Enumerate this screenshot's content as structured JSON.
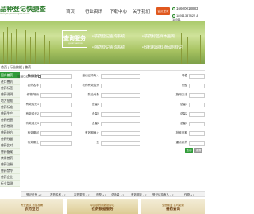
{
  "header": {
    "logo_text": "品种登记快捷查",
    "logo_sub": "Variety Registration Quick Search",
    "nav": [
      "首页",
      "行业资讯",
      "下载中心",
      "关于我们"
    ],
    "login_label": "会员登录",
    "phone1": "16600018883",
    "phone2": "18911387822 & 18911"
  },
  "banner": {
    "title": "查询服务",
    "title_en": "QUERY SERVICE",
    "items": [
      "农药登记查询系统",
      "农药标签样本查询",
      "农药标签化肥登记",
      "兽药登记查询系统",
      "饲料和饲料添加剂登记",
      "健康饲料登记查询"
    ]
  },
  "breadcrumb": [
    "首页",
    "行业数据",
    "兽药"
  ],
  "sidebar": {
    "items": [
      "国产兽药",
      "进口兽药",
      "兽药标签",
      "兽药说明",
      "地方批准",
      "兽药标准",
      "兽药生产",
      "兽药经营",
      "兽药检测",
      "兽药处方",
      "兽药残留",
      "兽药比对",
      "兽药备案",
      "禁用兽药",
      "兽药注册",
      "兽药禁令",
      "兽药企业",
      "行业监测"
    ],
    "active_index": 0
  },
  "form": {
    "rows": [
      [
        "登记证号",
        "登记证持有人",
        "毒性"
      ],
      [
        "农药名称",
        "农药有效成分",
        "剂型"
      ],
      [
        "作物/场所",
        "防治对象",
        "施用方法"
      ],
      [
        "有效成分1",
        "含量1",
        "总量1"
      ],
      [
        "有效成分2",
        "含量2",
        "总量2"
      ],
      [
        "有效成分3",
        "含量3",
        "总量3"
      ],
      [
        "有效期起",
        "有效期截止",
        "批准日期"
      ],
      [
        "有效期止",
        "至",
        "重点农药"
      ]
    ],
    "checkbox_label": "包括已过期数据",
    "search_button": "查询",
    "reset_button": "重置"
  },
  "table": {
    "headers": [
      "登记证号",
      "农药名称",
      "农药类别",
      "剂型",
      "总含量",
      "有效期至",
      "登记证持有人",
      "作物"
    ]
  },
  "ads": [
    {
      "line1": "专业团队 数据准确",
      "line2": "农药登记"
    },
    {
      "line1": "中国农药网数据中心",
      "line2": "农药数据服务"
    },
    {
      "line1": "全面覆盖 实时更新",
      "line2": "兽药查询"
    }
  ]
}
